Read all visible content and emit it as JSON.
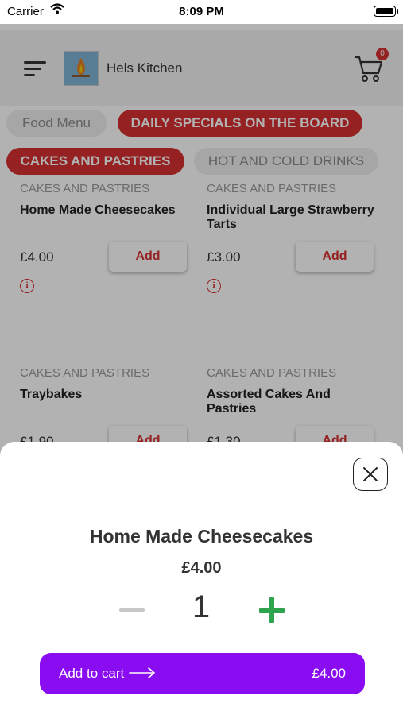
{
  "status_bar": {
    "carrier": "Carrier",
    "time": "8:09 PM"
  },
  "header": {
    "brand_name": "Hels Kitchen",
    "cart_count": "0"
  },
  "menu_tabs": [
    {
      "label": "Food Menu",
      "active": false
    },
    {
      "label": "DAILY SPECIALS ON THE BOARD",
      "active": true
    }
  ],
  "category_tabs": [
    {
      "label": "CAKES AND PASTRIES",
      "active": true
    },
    {
      "label": "HOT AND COLD DRINKS",
      "active": false
    }
  ],
  "products": [
    {
      "category": "CAKES AND PASTRIES",
      "name": "Home Made Cheesecakes",
      "price": "£4.00",
      "add_label": "Add"
    },
    {
      "category": "CAKES AND PASTRIES",
      "name": "Individual Large Strawberry Tarts",
      "price": "£3.00",
      "add_label": "Add"
    },
    {
      "category": "CAKES AND PASTRIES",
      "name": "Traybakes",
      "price": "£1.90",
      "add_label": "Add"
    },
    {
      "category": "CAKES AND PASTRIES",
      "name": "Assorted Cakes And Pastries",
      "price": "£1.30",
      "add_label": "Add"
    }
  ],
  "sheet": {
    "title": "Home Made Cheesecakes",
    "price": "£4.00",
    "quantity": "1",
    "add_to_cart_label": "Add to cart",
    "total": "£4.00"
  },
  "colors": {
    "accent_red": "#d63031",
    "purple": "#8a0cf0",
    "plus_green": "#2ea44f"
  },
  "icons": [
    "wifi-icon",
    "battery-icon",
    "menu-icon",
    "cart-icon",
    "info-icon",
    "close-icon",
    "minus-icon",
    "plus-icon",
    "arrow-right-icon"
  ]
}
